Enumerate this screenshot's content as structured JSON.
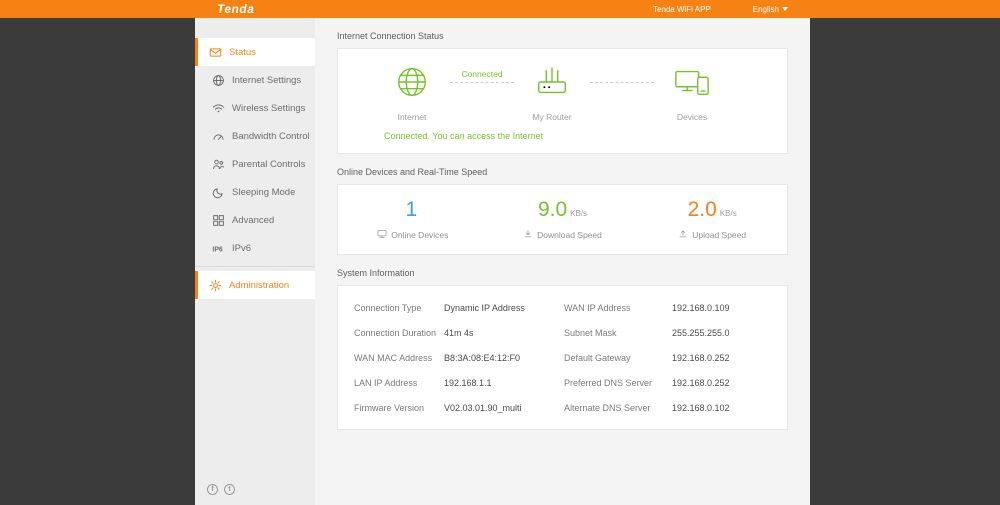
{
  "colors": {
    "accent": "#F78214",
    "green": "#75C32C",
    "blue": "#38A3EF"
  },
  "topbar": {
    "logo": "Tenda",
    "app_link": "Tenda WiFi APP",
    "language": "English"
  },
  "sidebar": {
    "items": [
      {
        "label": "Status",
        "active": true
      },
      {
        "label": "Internet Settings",
        "active": false
      },
      {
        "label": "Wireless Settings",
        "active": false
      },
      {
        "label": "Bandwidth Control",
        "active": false
      },
      {
        "label": "Parental Controls",
        "active": false
      },
      {
        "label": "Sleeping Mode",
        "active": false
      },
      {
        "label": "Advanced",
        "active": false
      },
      {
        "label": "IPv6",
        "active": false
      },
      {
        "label": "Administration",
        "active": true
      }
    ]
  },
  "connection": {
    "title": "Internet Connection Status",
    "internet_label": "Internet",
    "router_label": "My Router",
    "devices_label": "Devices",
    "link_label": "Connected",
    "status_text": "Connected. You can access the Internet"
  },
  "speed": {
    "title": "Online Devices and Real-Time Speed",
    "online": {
      "value": "1",
      "unit": "",
      "label": "Online Devices"
    },
    "download": {
      "value": "9.0",
      "unit": "KB/s",
      "label": "Download Speed"
    },
    "upload": {
      "value": "2.0",
      "unit": "KB/s",
      "label": "Upload Speed"
    }
  },
  "system": {
    "title": "System Information",
    "rows": [
      {
        "label_left": "Connection Type",
        "value_left": "Dynamic IP Address",
        "label_right": "WAN IP Address",
        "value_right": "192.168.0.109"
      },
      {
        "label_left": "Connection Duration",
        "value_left": "41m 4s",
        "label_right": "Subnet Mask",
        "value_right": "255.255.255.0"
      },
      {
        "label_left": "WAN MAC Address",
        "value_left": "B8:3A:08:E4:12:F0",
        "label_right": "Default Gateway",
        "value_right": "192.168.0.252"
      },
      {
        "label_left": "LAN IP Address",
        "value_left": "192.168.1.1",
        "label_right": "Preferred DNS Server",
        "value_right": "192.168.0.252"
      },
      {
        "label_left": "Firmware Version",
        "value_left": "V02.03.01.90_multi",
        "label_right": "Alternate DNS Server",
        "value_right": "192.168.0.102"
      }
    ]
  },
  "footer": {
    "social": [
      {
        "name": "facebook",
        "glyph": "f"
      },
      {
        "name": "twitter",
        "glyph": "t"
      }
    ]
  }
}
